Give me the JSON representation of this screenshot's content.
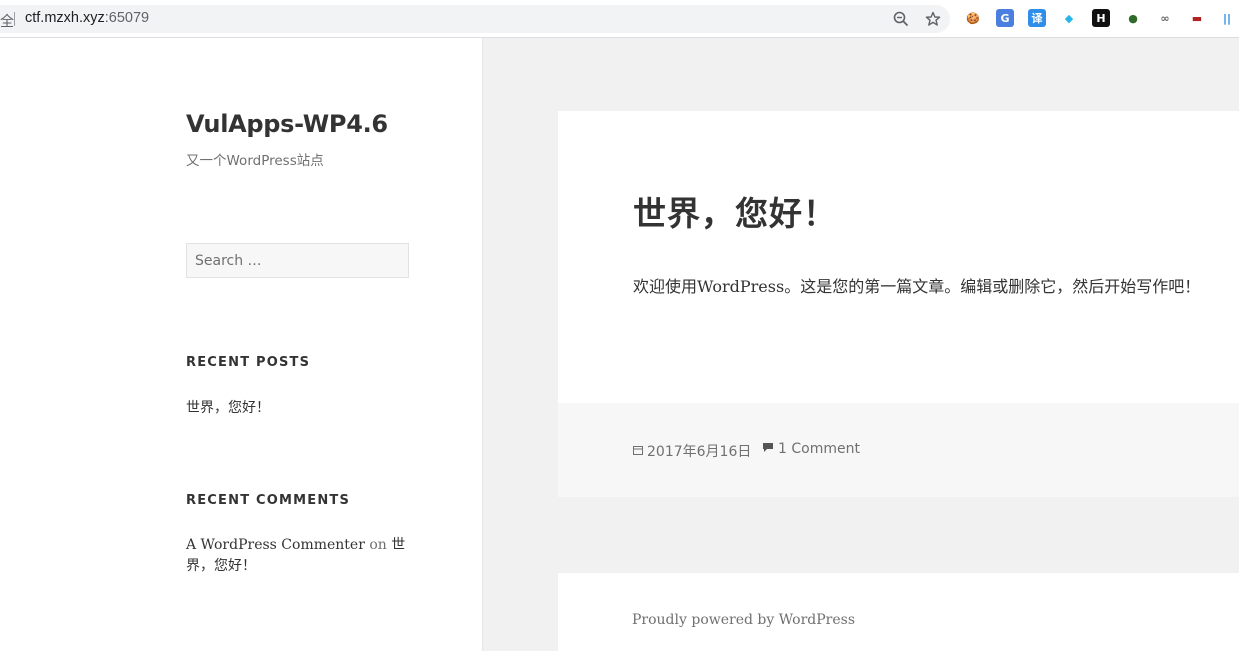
{
  "browser": {
    "security_label": "全",
    "url_host": "ctf.mzxh.xyz",
    "url_port": ":65079",
    "extensions": [
      {
        "name": "cookie-extension-icon",
        "glyph": "🍪",
        "color": "#d9a03a"
      },
      {
        "name": "translate-extension-icon",
        "glyph": "G",
        "color": "#4a7fe0"
      },
      {
        "name": "yi-translate-extension-icon",
        "glyph": "译",
        "color": "#2f8ee8"
      },
      {
        "name": "cube-extension-icon",
        "glyph": "◆",
        "color": "#27b6e8"
      },
      {
        "name": "h-extension-icon",
        "glyph": "H",
        "color": "#111111"
      },
      {
        "name": "green-ball-extension-icon",
        "glyph": "●",
        "color": "#2e6b2a"
      },
      {
        "name": "wing-extension-icon",
        "glyph": "∞",
        "color": "#666666"
      },
      {
        "name": "mask-extension-icon",
        "glyph": "▬",
        "color": "#b22222"
      },
      {
        "name": "sidebar-extension-icon",
        "glyph": "||",
        "color": "#1e88e5"
      }
    ]
  },
  "site": {
    "title": "VulApps-WP4.6",
    "description": "又一个WordPress站点"
  },
  "search": {
    "placeholder": "Search …"
  },
  "recent_posts": {
    "heading": "RECENT POSTS",
    "items": [
      "世界，您好！"
    ]
  },
  "recent_comments": {
    "heading": "RECENT COMMENTS",
    "author": "A WordPress Commenter",
    "on": "on",
    "post": "世界，您好！"
  },
  "post": {
    "title": "世界，您好！",
    "body": "欢迎使用WordPress。这是您的第一篇文章。编辑或删除它，然后开始写作吧！",
    "date": "2017年6月16日",
    "comments": "1 Comment"
  },
  "footer": {
    "text": "Proudly powered by WordPress"
  }
}
